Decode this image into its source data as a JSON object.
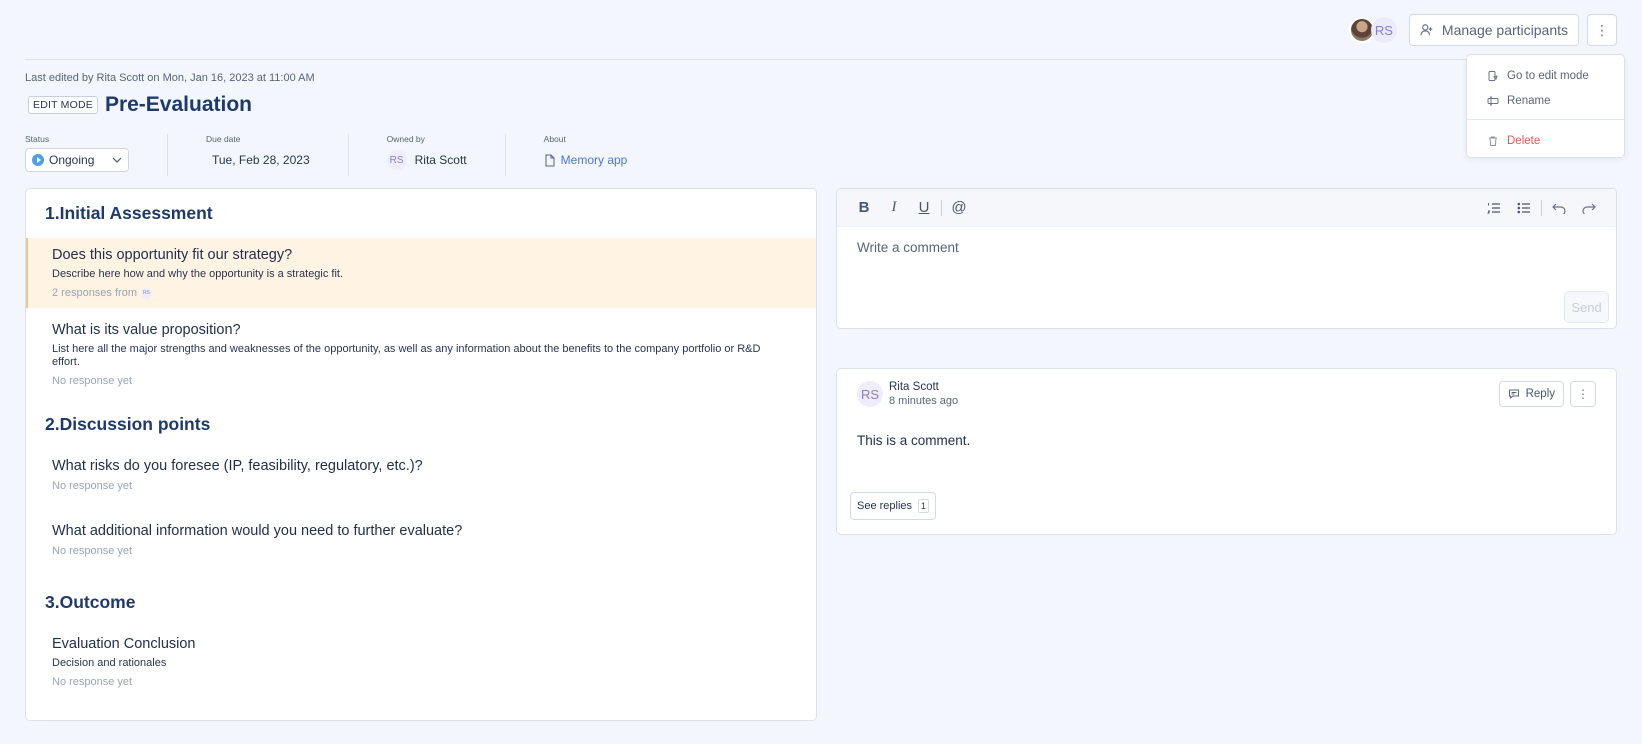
{
  "header": {
    "avatar_initials": "RS",
    "manage_participants_label": "Manage participants",
    "more_label": "⋮"
  },
  "menu": {
    "items": [
      {
        "label": "Go to edit mode",
        "icon": "edit-mode-icon"
      },
      {
        "label": "Rename",
        "icon": "rename-icon"
      },
      {
        "label": "Delete",
        "icon": "trash-icon"
      }
    ]
  },
  "document": {
    "last_edited": "Last edited by Rita Scott on Mon, Jan 16, 2023 at 11:00 AM",
    "mode_badge": "EDIT MODE",
    "title": "Pre-Evaluation"
  },
  "properties": {
    "status": {
      "label": "Status",
      "value": "Ongoing"
    },
    "due_date": {
      "label": "Due date",
      "value": "Tue, Feb 28, 2023"
    },
    "owned_by": {
      "label": "Owned by",
      "initials": "RS",
      "value": "Rita Scott"
    },
    "about": {
      "label": "About",
      "value": "Memory app"
    }
  },
  "sections": [
    {
      "title": "1.Initial Assessment",
      "questions": [
        {
          "title": "Does this opportunity fit our strategy?",
          "description": "Describe here how and why the opportunity is a strategic fit.",
          "response": "2 responses from",
          "response_initials": "RS"
        },
        {
          "title": "What is its value proposition?",
          "description": "List here all the major strengths and weaknesses of the opportunity, as well as any information about the benefits to the company portfolio or R&D effort.",
          "response": "No response yet"
        }
      ]
    },
    {
      "title": "2.Discussion points",
      "questions": [
        {
          "title": "What risks do you foresee (IP, feasibility, regulatory, etc.)?",
          "response": "No response yet"
        },
        {
          "title": "What additional information would you need to further evaluate?",
          "response": "No response yet"
        }
      ]
    },
    {
      "title": "3.Outcome",
      "questions": [
        {
          "title": "Evaluation Conclusion",
          "description": "Decision and rationales",
          "response": "No response yet"
        }
      ]
    }
  ],
  "editor": {
    "toolbar": {
      "bold": "B",
      "italic": "I",
      "underline": "U",
      "mention": "@"
    },
    "placeholder": "Write a comment",
    "send_label": "Send"
  },
  "comment": {
    "initials": "RS",
    "author": "Rita Scott",
    "time": "8 minutes ago",
    "reply_label": "Reply",
    "more_label": "⋮",
    "body": "This is a comment.",
    "see_replies_label": "See replies",
    "replies_count": "1"
  },
  "colors": {
    "accent": "#1f3a6a",
    "link": "#4b77d8",
    "delete": "#e05a4e",
    "active_bg": "#fff3e3",
    "status": "#4da0e6"
  }
}
